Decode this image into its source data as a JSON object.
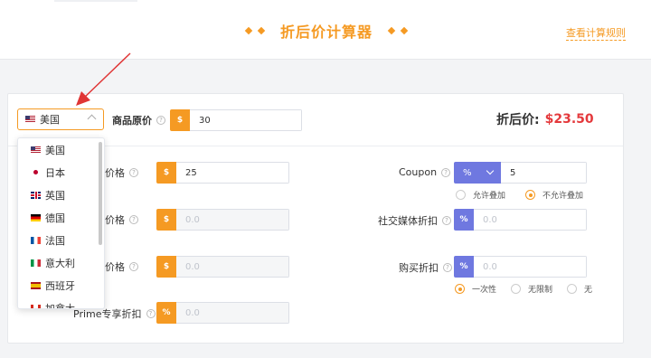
{
  "header": {
    "title": "折后价计算器",
    "rules_link": "查看计算规则"
  },
  "country_select": {
    "selected": "美国",
    "options": [
      "美国",
      "日本",
      "英国",
      "德国",
      "法国",
      "意大利",
      "西班牙",
      "加拿大"
    ]
  },
  "original_price": {
    "label": "商品原价",
    "prefix": "$",
    "value": "30"
  },
  "final_price": {
    "label": "折后价:",
    "value": "$23.50"
  },
  "left_fields": [
    {
      "label_visible": "秒杀价格",
      "prefix": "$",
      "value": "25",
      "placeholder": ""
    },
    {
      "label_visible": "促销价格",
      "prefix": "$",
      "value": "",
      "placeholder": "0.0"
    },
    {
      "label_visible": "奥斯价格",
      "prefix": "$",
      "value": "",
      "placeholder": "0.0"
    },
    {
      "label_visible": "Prime专享折扣",
      "prefix": "%",
      "value": "",
      "placeholder": "0.0"
    }
  ],
  "coupon": {
    "label": "Coupon",
    "unit": "%",
    "value": "5",
    "options": [
      {
        "label": "允许叠加",
        "selected": false
      },
      {
        "label": "不允许叠加",
        "selected": true
      }
    ]
  },
  "social_discount": {
    "label": "社交媒体折扣",
    "prefix": "%",
    "value": "",
    "placeholder": "0.0"
  },
  "purchase_discount": {
    "label": "购买折扣",
    "prefix": "%",
    "value": "",
    "placeholder": "0.0",
    "options": [
      {
        "label": "一次性",
        "selected": true
      },
      {
        "label": "无限制",
        "selected": false
      },
      {
        "label": "无",
        "selected": false
      }
    ]
  },
  "colors": {
    "accent": "#f59a23",
    "secondary": "#6f78e0",
    "price": "#e4393c",
    "arrow": "#e03535"
  },
  "icons": {
    "help": "question-circle-icon",
    "arrow": "annotation-arrow"
  }
}
